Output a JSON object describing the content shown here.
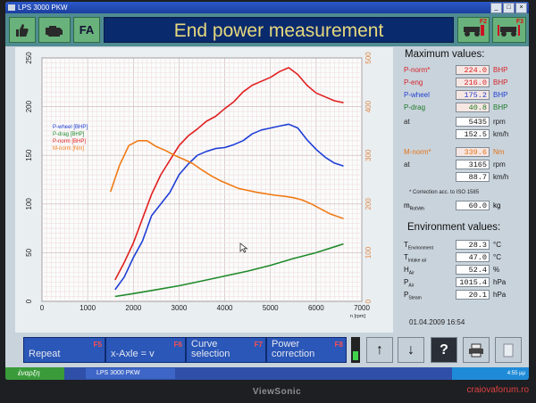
{
  "window": {
    "title": "LPS 3000 PKW"
  },
  "toolbar": {
    "fa_label": "FA",
    "title": "End power measurement",
    "f2_key": "F2",
    "f3_key": "F3"
  },
  "chart_data": {
    "type": "line",
    "x_ticks": [
      "0",
      "1000",
      "2000",
      "3000",
      "4000",
      "5000",
      "6000",
      "7000"
    ],
    "xlabel": "n [rpm]",
    "xlim": [
      0,
      7000
    ],
    "y_ticks": [
      "0",
      "50",
      "100",
      "150",
      "200",
      "250"
    ],
    "ylim": [
      0,
      250
    ],
    "y2_ticks": [
      "0",
      "100",
      "200",
      "300",
      "400",
      "500"
    ],
    "y2lim": [
      0,
      500
    ],
    "grid": true,
    "series": [
      {
        "name": "P-wheel [BHP]",
        "color": "#1e3fd6",
        "axis": "left",
        "x": [
          1600,
          1800,
          2000,
          2200,
          2400,
          2600,
          2800,
          3000,
          3200,
          3400,
          3600,
          3800,
          4000,
          4200,
          4400,
          4600,
          4800,
          5000,
          5200,
          5400,
          5600,
          5800,
          6000,
          6200,
          6400,
          6600
        ],
        "y": [
          12,
          25,
          45,
          62,
          88,
          100,
          112,
          130,
          141,
          150,
          154,
          157,
          158,
          161,
          165,
          172,
          176,
          178,
          180,
          182,
          178,
          166,
          156,
          148,
          142,
          139
        ]
      },
      {
        "name": "P-drag [BHP]",
        "color": "#1f8a2a",
        "axis": "left",
        "x": [
          1600,
          2000,
          2500,
          3000,
          3500,
          4000,
          4500,
          5000,
          5500,
          6000,
          6600
        ],
        "y": [
          5,
          8,
          12,
          16,
          21,
          26,
          31,
          37,
          44,
          50,
          59
        ]
      },
      {
        "name": "P-norm [BHP]",
        "color": "#e02020",
        "axis": "left",
        "x": [
          1600,
          1800,
          2000,
          2200,
          2400,
          2600,
          2800,
          3000,
          3200,
          3400,
          3600,
          3800,
          4000,
          4200,
          4400,
          4600,
          4800,
          5000,
          5200,
          5400,
          5600,
          5800,
          6000,
          6200,
          6400,
          6600
        ],
        "y": [
          22,
          40,
          60,
          85,
          110,
          130,
          145,
          160,
          170,
          177,
          185,
          190,
          198,
          205,
          215,
          222,
          226,
          230,
          236,
          240,
          233,
          222,
          214,
          210,
          206,
          204
        ]
      },
      {
        "name": "M-norm [Nm]",
        "color": "#f07a14",
        "axis": "right",
        "x": [
          1500,
          1700,
          1900,
          2100,
          2300,
          2500,
          2700,
          2900,
          3100,
          3300,
          3500,
          3700,
          3900,
          4100,
          4300,
          4500,
          4700,
          4900,
          5100,
          5300,
          5500,
          5700,
          5900,
          6100,
          6300,
          6600
        ],
        "y": [
          225,
          280,
          320,
          330,
          330,
          318,
          310,
          300,
          292,
          283,
          270,
          258,
          248,
          240,
          232,
          228,
          224,
          221,
          218,
          216,
          213,
          208,
          200,
          190,
          180,
          170
        ]
      }
    ]
  },
  "right_panel": {
    "max_title": "Maximum values:",
    "env_title": "Environment values:",
    "correction_note": "* Correction acc. to ISO 1585",
    "datetime": "01.04.2009  16:54",
    "max_rows": [
      {
        "label": "P-norm*",
        "value": "224.0",
        "unit": "BHP",
        "color": "#d8232a"
      },
      {
        "label": "P-eng",
        "value": "216.0",
        "unit": "BHP",
        "color": "#d8232a"
      },
      {
        "label": "P-wheel",
        "value": "175.2",
        "unit": "BHP",
        "color": "#1f3fd0"
      },
      {
        "label": "P-drag",
        "value": "40.8",
        "unit": "BHP",
        "color": "#1f7a2a"
      },
      {
        "label": "at",
        "value": "5435",
        "unit": "rpm",
        "color": "#222"
      },
      {
        "label": "",
        "value": "152.5",
        "unit": "km/h",
        "color": "#222"
      },
      {
        "label": "M-norm*",
        "value": "339.6",
        "unit": "Nm",
        "color": "#e4751a"
      },
      {
        "label": "at",
        "value": "3165",
        "unit": "rpm",
        "color": "#222"
      },
      {
        "label": "",
        "value": "88.7",
        "unit": "km/h",
        "color": "#222"
      }
    ],
    "mass_row": {
      "label": "m",
      "sub": "RotVeh",
      "value": "60.0",
      "unit": "kg"
    },
    "env_rows": [
      {
        "label": "T",
        "sub": "Environment",
        "value": "28.3",
        "unit": "°C"
      },
      {
        "label": "T",
        "sub": "Intake air",
        "value": "47.0",
        "unit": "°C"
      },
      {
        "label": "H",
        "sub": "Air",
        "value": "52.4",
        "unit": "%"
      },
      {
        "label": "P",
        "sub": "Air",
        "value": "1015.4",
        "unit": "hPa"
      },
      {
        "label": "P",
        "sub": "Steam",
        "value": "20.1",
        "unit": "hPa"
      }
    ]
  },
  "function_bar": {
    "repeat": {
      "label": "Repeat",
      "key": "F5"
    },
    "xaxle": {
      "label": "x-Axle = v",
      "key": "F6"
    },
    "curve": {
      "label": "Curve selection",
      "key": "F7"
    },
    "power": {
      "label": "Power correction",
      "key": "F8"
    },
    "up_glyph": "↑",
    "down_glyph": "↓",
    "help_glyph": "?"
  },
  "taskbar": {
    "start": "έναρξη",
    "task": "LPS 3000 PKW",
    "lang": "EN",
    "clock": "4:55 μμ"
  },
  "monitor": {
    "brand": "ViewSonic"
  },
  "watermark": "craiovaforum.ro"
}
